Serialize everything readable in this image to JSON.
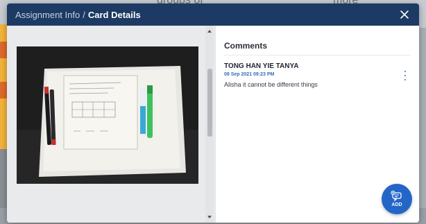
{
  "background": {
    "text_left": "groups of",
    "text_right": "more"
  },
  "modal": {
    "breadcrumb": {
      "parent": "Assignment Info",
      "separator": "/",
      "current": "Card Details"
    },
    "close_icon": "close-icon"
  },
  "comments": {
    "title": "Comments",
    "items": [
      {
        "author": "TONG HAN YIE TANYA",
        "time": "08 Sep 2021 09:23 PM",
        "text": "Alisha it cannot be different things"
      }
    ]
  },
  "add_button": {
    "label": "ADD",
    "icon": "add-comment-icon"
  },
  "colors": {
    "header": "#1c3a63",
    "accent": "#2466c8",
    "timestamp": "#2f6fb5"
  }
}
